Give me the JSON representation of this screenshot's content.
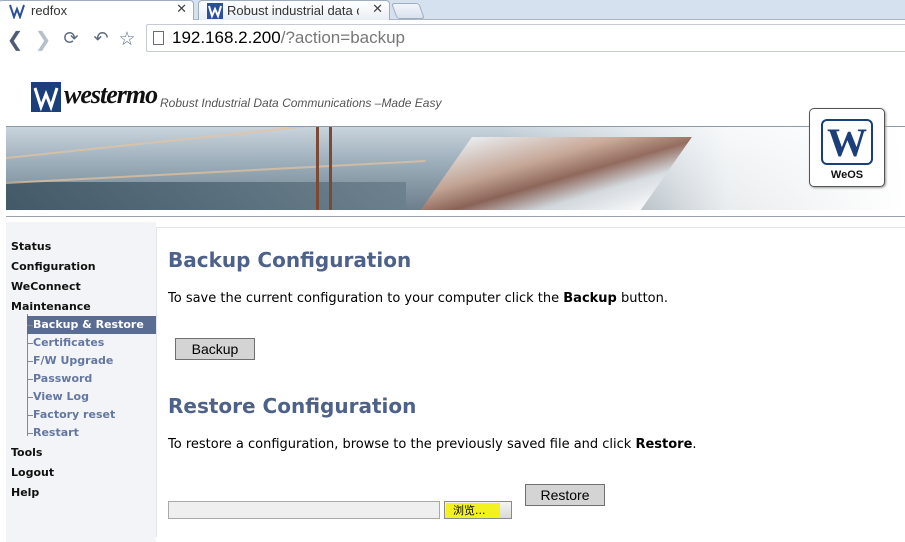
{
  "browser": {
    "tabs": [
      {
        "title": "redfox",
        "active": true
      },
      {
        "title": "Robust industrial data c",
        "active": false
      }
    ],
    "url_host": "192.168.2.200",
    "url_rest": "/?action=backup",
    "icons": [
      "back-icon",
      "forward-icon",
      "reload-icon",
      "undo-icon",
      "bookmark-star-icon",
      "close-icon",
      "page-icon"
    ]
  },
  "header": {
    "brand": "westermo",
    "tagline": "Robust Industrial Data Communications  –Made Easy",
    "badge_label": "WeOS",
    "badge_mark": "W"
  },
  "sidebar": {
    "items": [
      {
        "label": "Status"
      },
      {
        "label": "Configuration"
      },
      {
        "label": "WeConnect"
      },
      {
        "label": "Maintenance"
      }
    ],
    "subitems": [
      {
        "label": "Backup & Restore",
        "active": true
      },
      {
        "label": "Certificates",
        "active": false
      },
      {
        "label": "F/W Upgrade",
        "active": false
      },
      {
        "label": "Password",
        "active": false
      },
      {
        "label": "View Log",
        "active": false
      },
      {
        "label": "Factory reset",
        "active": false
      },
      {
        "label": "Restart",
        "active": false
      }
    ],
    "bottom_items": [
      {
        "label": "Tools"
      },
      {
        "label": "Logout"
      },
      {
        "label": "Help"
      }
    ]
  },
  "main": {
    "backup": {
      "title": "Backup Configuration",
      "text_before": "To save the current configuration to your computer click the ",
      "text_bold": "Backup",
      "text_after": " button.",
      "button_label": "Backup"
    },
    "restore": {
      "title": "Restore Configuration",
      "text_before": "To restore a configuration, browse to the previously saved file and click ",
      "text_bold": "Restore",
      "text_after": ".",
      "file_value": "",
      "browse_label": "浏览...",
      "button_label": "Restore"
    }
  },
  "colors": {
    "heading": "#4e6289",
    "active_nav_bg": "#5b6c93",
    "subnav_text": "#6477a1",
    "brand_blue": "#1a3f7a"
  }
}
